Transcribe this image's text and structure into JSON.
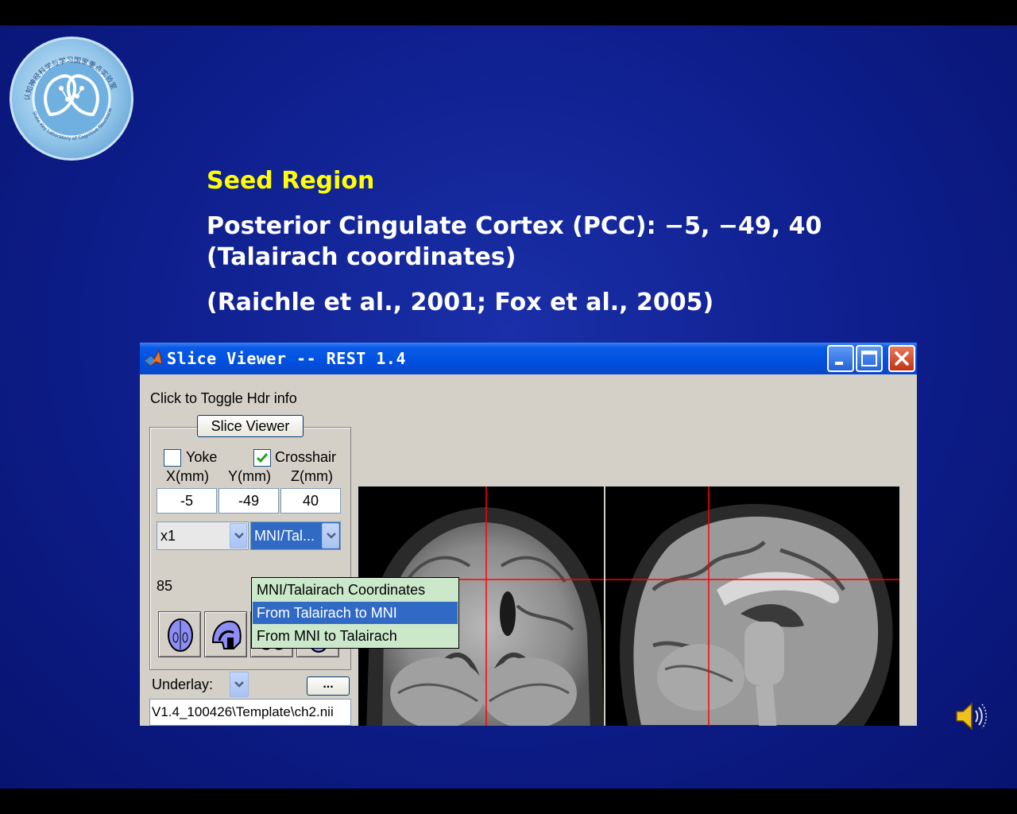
{
  "slide": {
    "heading": "Seed Region",
    "line1": "Posterior Cingulate Cortex (PCC): −5, −49, 40",
    "line2": "(Talairach coordinates)",
    "reference": "(Raichle et al., 2001; Fox et al., 2005)"
  },
  "logo": {
    "text_cn": "认知神经科学与学习国家重点实验室",
    "text_en": "State Key Laboratory of Cognitive Neuroscience and Learning"
  },
  "window": {
    "title": "Slice Viewer -- REST 1.4",
    "icons": {
      "app": "matlab-icon",
      "minimize": "minimize-icon",
      "maximize": "maximize-icon",
      "close": "close-icon"
    }
  },
  "panel": {
    "hdr_toggle": "Click to Toggle Hdr info",
    "slice_viewer_button": "Slice Viewer",
    "yoke_label": "Yoke",
    "yoke_checked": false,
    "crosshair_label": "Crosshair",
    "crosshair_checked": true,
    "axis_labels": [
      "X(mm)",
      "Y(mm)",
      "Z(mm)"
    ],
    "coords": [
      "-5",
      "-49",
      "40"
    ],
    "zoom_value": "x1",
    "coord_system_value": "MNI/Tal...",
    "intensity_value": "85",
    "view_buttons": [
      "axial-view-icon",
      "sagittal-view-icon",
      "coronal-view-icon",
      "montage-view-icon"
    ],
    "underlay_label": "Underlay:",
    "browse_button": "...",
    "underlay_path": "V1.4_100426\\Template\\ch2.nii"
  },
  "dropdown": {
    "options": [
      "MNI/Talairach Coordinates",
      "From Talairach to MNI",
      "From MNI to Talairach"
    ],
    "highlighted_index": 1
  },
  "colors": {
    "heading_yellow": "#ffff00",
    "crosshair_red": "#ff0000",
    "highlight_blue": "#316ac5",
    "menu_green": "#cbe8cb"
  },
  "speaker_icon": "speaker-icon"
}
